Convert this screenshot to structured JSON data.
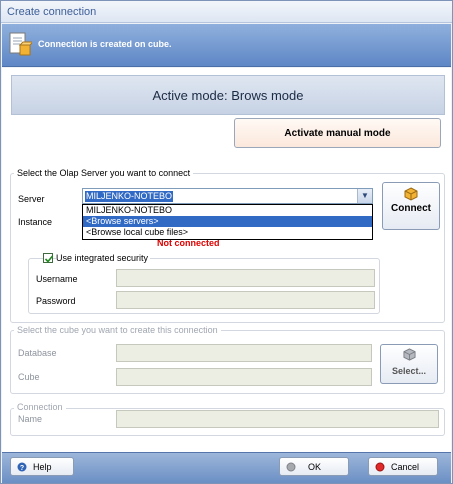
{
  "window": {
    "title": "Create connection"
  },
  "banner": {
    "text": "Connection is created on cube."
  },
  "mode": {
    "title": "Active mode: Brows mode",
    "manual_button": "Activate manual mode"
  },
  "server_group": {
    "legend": "Select the Olap Server you want to connect",
    "server_label": "Server",
    "server_value": "MILJENKO-NOTEBO",
    "server_options": [
      "MILJENKO-NOTEBO",
      "<Browse servers>",
      "<Browse local cube files>"
    ],
    "server_selected_option": "<Browse servers>",
    "instance_label": "Instance",
    "status": "Not connected",
    "connect_button": "Connect",
    "integrated_security_label": "Use integrated security",
    "integrated_security_checked": true,
    "username_label": "Username",
    "username_value": "",
    "password_label": "Password",
    "password_value": ""
  },
  "cube_group": {
    "legend": "Select the cube you want to create this connection",
    "database_label": "Database",
    "database_value": "",
    "cube_label": "Cube",
    "cube_value": "",
    "select_button": "Select..."
  },
  "connection_group": {
    "legend": "Connection",
    "name_label": "Name",
    "name_value": ""
  },
  "footer": {
    "help_button": "Help",
    "ok_button": "OK",
    "cancel_button": "Cancel"
  },
  "colors": {
    "status_red": "#e00000",
    "selection_blue": "#316ac5",
    "banner_blue": "#5f87c6"
  },
  "icons": {
    "banner": "connection-document-icon",
    "connect": "cube-icon",
    "select": "cube-grey-icon",
    "help": "help-icon",
    "ok": "grey-dot-icon",
    "cancel": "red-dot-icon"
  }
}
